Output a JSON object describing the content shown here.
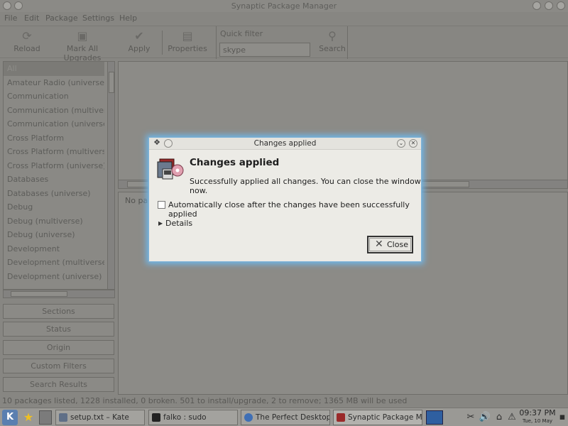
{
  "app": {
    "title": "Synaptic Package Manager"
  },
  "menu": [
    "File",
    "Edit",
    "Package",
    "Settings",
    "Help"
  ],
  "toolbar": {
    "reload": "Reload",
    "mark_all": "Mark All Upgrades",
    "apply": "Apply",
    "properties": "Properties",
    "quick_filter_label": "Quick filter",
    "quick_filter_value": "skype",
    "search": "Search"
  },
  "sections": {
    "items": [
      "All",
      "Amateur Radio (universe)",
      "Communication",
      "Communication (multiverse)",
      "Communication (universe)",
      "Cross Platform",
      "Cross Platform (multiverse)",
      "Cross Platform (universe)",
      "Databases",
      "Databases (universe)",
      "Debug",
      "Debug (multiverse)",
      "Debug (universe)",
      "Development",
      "Development (multiverse)",
      "Development (universe)"
    ]
  },
  "filter_buttons": [
    "Sections",
    "Status",
    "Origin",
    "Custom Filters",
    "Search Results"
  ],
  "description": {
    "text": "No package is selected."
  },
  "status_bar": "10 packages listed, 1228 installed, 0 broken. 501 to install/upgrade, 2 to remove; 1365 MB will be used",
  "dialog": {
    "title": "Changes applied",
    "heading": "Changes applied",
    "message": "Successfully applied all changes. You can close the window now.",
    "auto_close_label": "Automatically close after the changes have been successfully applied",
    "auto_close_checked": false,
    "details": "Details",
    "close": "Close"
  },
  "taskbar": {
    "tasks": [
      {
        "label": "setup.txt – Kate",
        "active": false
      },
      {
        "label": "falko : sudo",
        "active": false
      },
      {
        "label": "The Perfect Desktop -",
        "active": false
      },
      {
        "label": "Synaptic Package Mana",
        "active": true
      }
    ],
    "clock_time": "09:37 PM",
    "clock_date": "Tue, 10 May"
  }
}
